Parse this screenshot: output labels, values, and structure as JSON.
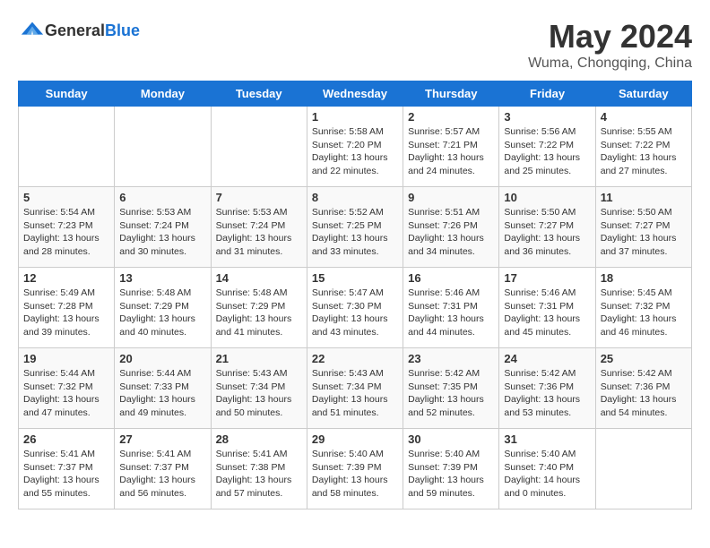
{
  "header": {
    "logo_general": "General",
    "logo_blue": "Blue",
    "month": "May 2024",
    "location": "Wuma, Chongqing, China"
  },
  "days_of_week": [
    "Sunday",
    "Monday",
    "Tuesday",
    "Wednesday",
    "Thursday",
    "Friday",
    "Saturday"
  ],
  "weeks": [
    [
      {
        "day": "",
        "sunrise": "",
        "sunset": "",
        "daylight": ""
      },
      {
        "day": "",
        "sunrise": "",
        "sunset": "",
        "daylight": ""
      },
      {
        "day": "",
        "sunrise": "",
        "sunset": "",
        "daylight": ""
      },
      {
        "day": "1",
        "sunrise": "Sunrise: 5:58 AM",
        "sunset": "Sunset: 7:20 PM",
        "daylight": "Daylight: 13 hours and 22 minutes."
      },
      {
        "day": "2",
        "sunrise": "Sunrise: 5:57 AM",
        "sunset": "Sunset: 7:21 PM",
        "daylight": "Daylight: 13 hours and 24 minutes."
      },
      {
        "day": "3",
        "sunrise": "Sunrise: 5:56 AM",
        "sunset": "Sunset: 7:22 PM",
        "daylight": "Daylight: 13 hours and 25 minutes."
      },
      {
        "day": "4",
        "sunrise": "Sunrise: 5:55 AM",
        "sunset": "Sunset: 7:22 PM",
        "daylight": "Daylight: 13 hours and 27 minutes."
      }
    ],
    [
      {
        "day": "5",
        "sunrise": "Sunrise: 5:54 AM",
        "sunset": "Sunset: 7:23 PM",
        "daylight": "Daylight: 13 hours and 28 minutes."
      },
      {
        "day": "6",
        "sunrise": "Sunrise: 5:53 AM",
        "sunset": "Sunset: 7:24 PM",
        "daylight": "Daylight: 13 hours and 30 minutes."
      },
      {
        "day": "7",
        "sunrise": "Sunrise: 5:53 AM",
        "sunset": "Sunset: 7:24 PM",
        "daylight": "Daylight: 13 hours and 31 minutes."
      },
      {
        "day": "8",
        "sunrise": "Sunrise: 5:52 AM",
        "sunset": "Sunset: 7:25 PM",
        "daylight": "Daylight: 13 hours and 33 minutes."
      },
      {
        "day": "9",
        "sunrise": "Sunrise: 5:51 AM",
        "sunset": "Sunset: 7:26 PM",
        "daylight": "Daylight: 13 hours and 34 minutes."
      },
      {
        "day": "10",
        "sunrise": "Sunrise: 5:50 AM",
        "sunset": "Sunset: 7:27 PM",
        "daylight": "Daylight: 13 hours and 36 minutes."
      },
      {
        "day": "11",
        "sunrise": "Sunrise: 5:50 AM",
        "sunset": "Sunset: 7:27 PM",
        "daylight": "Daylight: 13 hours and 37 minutes."
      }
    ],
    [
      {
        "day": "12",
        "sunrise": "Sunrise: 5:49 AM",
        "sunset": "Sunset: 7:28 PM",
        "daylight": "Daylight: 13 hours and 39 minutes."
      },
      {
        "day": "13",
        "sunrise": "Sunrise: 5:48 AM",
        "sunset": "Sunset: 7:29 PM",
        "daylight": "Daylight: 13 hours and 40 minutes."
      },
      {
        "day": "14",
        "sunrise": "Sunrise: 5:48 AM",
        "sunset": "Sunset: 7:29 PM",
        "daylight": "Daylight: 13 hours and 41 minutes."
      },
      {
        "day": "15",
        "sunrise": "Sunrise: 5:47 AM",
        "sunset": "Sunset: 7:30 PM",
        "daylight": "Daylight: 13 hours and 43 minutes."
      },
      {
        "day": "16",
        "sunrise": "Sunrise: 5:46 AM",
        "sunset": "Sunset: 7:31 PM",
        "daylight": "Daylight: 13 hours and 44 minutes."
      },
      {
        "day": "17",
        "sunrise": "Sunrise: 5:46 AM",
        "sunset": "Sunset: 7:31 PM",
        "daylight": "Daylight: 13 hours and 45 minutes."
      },
      {
        "day": "18",
        "sunrise": "Sunrise: 5:45 AM",
        "sunset": "Sunset: 7:32 PM",
        "daylight": "Daylight: 13 hours and 46 minutes."
      }
    ],
    [
      {
        "day": "19",
        "sunrise": "Sunrise: 5:44 AM",
        "sunset": "Sunset: 7:32 PM",
        "daylight": "Daylight: 13 hours and 47 minutes."
      },
      {
        "day": "20",
        "sunrise": "Sunrise: 5:44 AM",
        "sunset": "Sunset: 7:33 PM",
        "daylight": "Daylight: 13 hours and 49 minutes."
      },
      {
        "day": "21",
        "sunrise": "Sunrise: 5:43 AM",
        "sunset": "Sunset: 7:34 PM",
        "daylight": "Daylight: 13 hours and 50 minutes."
      },
      {
        "day": "22",
        "sunrise": "Sunrise: 5:43 AM",
        "sunset": "Sunset: 7:34 PM",
        "daylight": "Daylight: 13 hours and 51 minutes."
      },
      {
        "day": "23",
        "sunrise": "Sunrise: 5:42 AM",
        "sunset": "Sunset: 7:35 PM",
        "daylight": "Daylight: 13 hours and 52 minutes."
      },
      {
        "day": "24",
        "sunrise": "Sunrise: 5:42 AM",
        "sunset": "Sunset: 7:36 PM",
        "daylight": "Daylight: 13 hours and 53 minutes."
      },
      {
        "day": "25",
        "sunrise": "Sunrise: 5:42 AM",
        "sunset": "Sunset: 7:36 PM",
        "daylight": "Daylight: 13 hours and 54 minutes."
      }
    ],
    [
      {
        "day": "26",
        "sunrise": "Sunrise: 5:41 AM",
        "sunset": "Sunset: 7:37 PM",
        "daylight": "Daylight: 13 hours and 55 minutes."
      },
      {
        "day": "27",
        "sunrise": "Sunrise: 5:41 AM",
        "sunset": "Sunset: 7:37 PM",
        "daylight": "Daylight: 13 hours and 56 minutes."
      },
      {
        "day": "28",
        "sunrise": "Sunrise: 5:41 AM",
        "sunset": "Sunset: 7:38 PM",
        "daylight": "Daylight: 13 hours and 57 minutes."
      },
      {
        "day": "29",
        "sunrise": "Sunrise: 5:40 AM",
        "sunset": "Sunset: 7:39 PM",
        "daylight": "Daylight: 13 hours and 58 minutes."
      },
      {
        "day": "30",
        "sunrise": "Sunrise: 5:40 AM",
        "sunset": "Sunset: 7:39 PM",
        "daylight": "Daylight: 13 hours and 59 minutes."
      },
      {
        "day": "31",
        "sunrise": "Sunrise: 5:40 AM",
        "sunset": "Sunset: 7:40 PM",
        "daylight": "Daylight: 14 hours and 0 minutes."
      },
      {
        "day": "",
        "sunrise": "",
        "sunset": "",
        "daylight": ""
      }
    ]
  ]
}
